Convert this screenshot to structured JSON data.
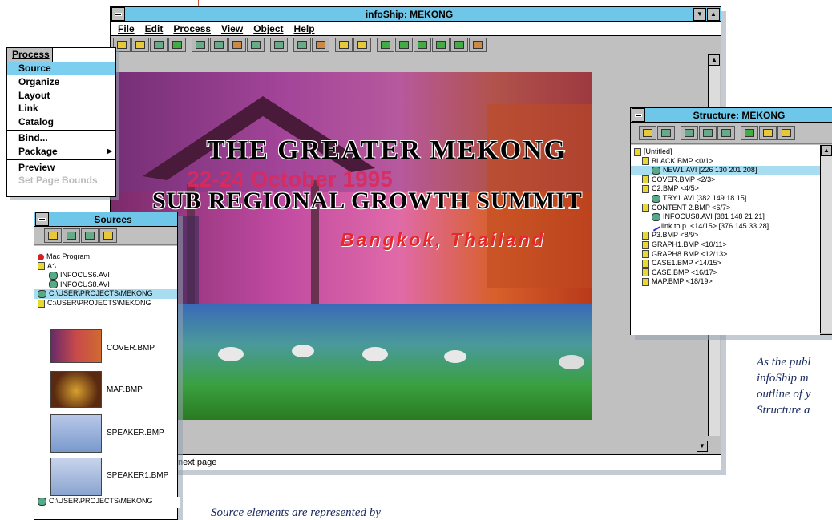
{
  "main_window": {
    "title": "infoShip: MEKONG",
    "menus": [
      "File",
      "Edit",
      "Process",
      "View",
      "Object",
      "Help"
    ],
    "status_text": "next page"
  },
  "slide": {
    "line1": "THE GREATER MEKONG",
    "line2": "22-24 October 1995",
    "line3": "SUB REGIONAL GROWTH SUMMIT",
    "line4": "Bangkok, Thailand"
  },
  "process_menu": {
    "title": "Process",
    "items": [
      "Source",
      "Organize",
      "Layout",
      "Link",
      "Catalog",
      "Bind...",
      "Package",
      "Preview",
      "Set Page Bounds"
    ]
  },
  "sources_window": {
    "title": "Sources",
    "items": [
      "Mac Program",
      "A:\\",
      "INFOCUS6.AVI",
      "INFOCUS8.AVI",
      "C:\\USER\\PROJECTS\\MEKONG",
      "C:\\USER\\PROJECTS\\MEKONG"
    ],
    "thumbnails": [
      "COVER.BMP",
      "MAP.BMP",
      "SPEAKER.BMP",
      "SPEAKER1.BMP"
    ],
    "footer_item": "C:\\USER\\PROJECTS\\MEKONG"
  },
  "structure_window": {
    "title": "Structure: MEKONG",
    "items": [
      "[Untitled]",
      "BLACK.BMP <0/1>",
      "NEW1.AVI  [226 130 201 208]",
      "COVER.BMP <2/3>",
      "C2.BMP <4/5>",
      "TRY1.AVI  [382 149 18 15]",
      "CONTENT 2.BMP <6/7>",
      "INFOCUS8.AVI  [381 148 21 21]",
      "link to p. <14/15> [376 145 33 28]",
      "P3.BMP <8/9>",
      "GRAPH1.BMP <10/11>",
      "GRAPH8.BMP <12/13>",
      "CASE1.BMP <14/15>",
      "CASE.BMP <16/17>",
      "MAP.BMP <18/19>"
    ]
  },
  "captions": {
    "right_lines": [
      "As the publ",
      "infoShip m",
      "outline of y",
      "Structure a"
    ],
    "bottom": "Source elements are represented by"
  },
  "colors": {
    "titlebar": "#6ec6e8",
    "selection": "#a8dcf0",
    "menu_highlight": "#7ccfee"
  }
}
